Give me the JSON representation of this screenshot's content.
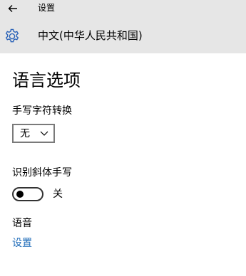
{
  "header": {
    "app_title": "设置",
    "page_heading": "中文(中华人民共和国)"
  },
  "main": {
    "section_title": "语言选项",
    "handwriting": {
      "label": "手写字符转换",
      "selected_value": "无"
    },
    "italic_recognition": {
      "label": "识别斜体手写",
      "toggle_state": "关",
      "on": false
    },
    "language": {
      "label": "语音",
      "link_label": "设置"
    }
  },
  "icons": {
    "back": "arrow-left-icon",
    "settings": "gear-icon",
    "dropdown": "chevron-down-icon"
  },
  "colors": {
    "header_bg": "#e6e6e6",
    "accent": "#1e6bb8",
    "icon_blue": "#2b63b8"
  }
}
